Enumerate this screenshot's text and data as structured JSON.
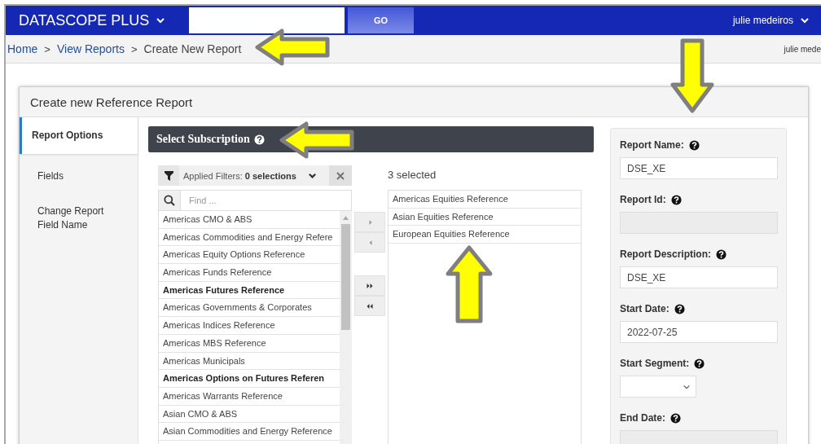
{
  "topbar": {
    "title": "DATASCOPE PLUS",
    "go_button": "GO",
    "user": "julie medeiros"
  },
  "breadcrumb": [
    {
      "label": "Home",
      "kind": "link"
    },
    {
      "label": ">",
      "kind": "separator"
    },
    {
      "label": "View Reports",
      "kind": "link"
    },
    {
      "label": ">",
      "kind": "separator"
    },
    {
      "label": "Create New Report",
      "kind": "current"
    }
  ],
  "breadcrumb_user": "julie mede",
  "card": {
    "title": "Create new Reference Report"
  },
  "nav": [
    {
      "label": "Report Options",
      "selected": true
    },
    {
      "label": "Fields",
      "selected": false
    },
    {
      "label": "Change Report Field Name",
      "selected": false
    }
  ],
  "subscription": {
    "title": "Select Subscription",
    "filter": "Applied Filters: **0 selections**",
    "find_placeholder": "Find ...",
    "available": [
      {
        "label": "Americas CMO & ABS",
        "bold": false
      },
      {
        "label": "Americas Commodities and Energy Refere",
        "bold": false
      },
      {
        "label": "Americas Equity Options Reference",
        "bold": false
      },
      {
        "label": "Americas Funds Reference",
        "bold": false
      },
      {
        "label": "Americas Futures Reference",
        "bold": true
      },
      {
        "label": "Americas Governments & Corporates",
        "bold": false
      },
      {
        "label": "Americas Indices Reference",
        "bold": false
      },
      {
        "label": "Americas MBS Reference",
        "bold": false
      },
      {
        "label": "Americas Municipals",
        "bold": false
      },
      {
        "label": "Americas Options on Futures Referen",
        "bold": true
      },
      {
        "label": "Americas Warrants Reference",
        "bold": false
      },
      {
        "label": "Asian CMO & ABS",
        "bold": false
      },
      {
        "label": "Asian Commodities and Energy Reference",
        "bold": false
      }
    ],
    "selected_count": "3 selected",
    "selected": [
      "Americas Equities Reference",
      "Asian Equities Reference",
      "European Equities Reference"
    ]
  },
  "form": [
    {
      "label": "Report Name:",
      "kind": "text",
      "value": "DSE_XE",
      "disabled": false
    },
    {
      "label": "Report Id:",
      "kind": "text",
      "disabled": true
    },
    {
      "label": "Report Description:",
      "kind": "text",
      "value": "DSE_XE",
      "disabled": false
    },
    {
      "label": "Start Date:",
      "kind": "text",
      "value": "2022-07-25",
      "disabled": false
    },
    {
      "label": "Start Segment:",
      "kind": "select",
      "disabled": false
    },
    {
      "label": "End Date:",
      "kind": "text",
      "disabled": true
    }
  ],
  "callouts": [
    {
      "kind": "left"
    },
    {
      "kind": "down"
    },
    {
      "kind": "left"
    },
    {
      "kind": "up"
    }
  ]
}
